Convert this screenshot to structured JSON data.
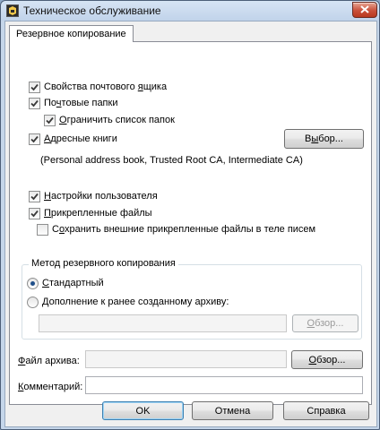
{
  "window": {
    "title": "Техническое обслуживание"
  },
  "tab": {
    "label": "Резервное копирование"
  },
  "options": {
    "mailbox_properties": {
      "pre": "Свойства почтового ",
      "key": "я",
      "post": "щика",
      "checked": true
    },
    "mail_folders": {
      "pre": "По",
      "key": "ч",
      "post": "товые папки",
      "checked": true
    },
    "limit_folders": {
      "pre": "",
      "key": "О",
      "post": "граничить список папок",
      "checked": true
    },
    "address_books": {
      "pre": "",
      "key": "А",
      "post": "дресные книги",
      "checked": true
    },
    "address_books_note": "(Personal address book, Trusted Root CA, Intermediate CA)",
    "user_settings": {
      "pre": "",
      "key": "Н",
      "post": "астройки пользователя",
      "checked": true
    },
    "attachments": {
      "pre": "",
      "key": "П",
      "post": "рикрепленные файлы",
      "checked": true
    },
    "save_external": {
      "pre": "С",
      "key": "о",
      "post": "хранить внешние прикрепленные файлы в теле писем",
      "checked": false
    }
  },
  "select_button": {
    "pre": "В",
    "key": "ы",
    "post": "бор..."
  },
  "backup_method": {
    "title": "Метод резервного копирования",
    "standard": {
      "pre": "",
      "key": "С",
      "post": "тандартный",
      "selected": true
    },
    "append": {
      "pre": "",
      "key": "Д",
      "post": "ополнение к ранее созданному архиву:",
      "selected": false
    },
    "append_path": "",
    "browse_disabled": {
      "pre": "",
      "key": "О",
      "post": "бзор..."
    }
  },
  "archive": {
    "label_pre": "",
    "label_key": "Ф",
    "label_post": "айл архива:",
    "value": "",
    "browse": {
      "pre": "",
      "key": "О",
      "post": "бзор..."
    }
  },
  "comment": {
    "label_pre": "",
    "label_key": "К",
    "label_post": "омментарий:",
    "value": ""
  },
  "buttons": {
    "ok": "OK",
    "cancel": "Отмена",
    "help": "Справка"
  },
  "icons": {
    "app": "app-icon",
    "close": "close-icon",
    "check": "checkmark-icon"
  },
  "colors": {
    "title_bar": "#c1d3ea",
    "close_button": "#c9503a",
    "client_background": "#f0f0f0",
    "panel_background": "#ffffff",
    "radio_dot": "#1f4f8a"
  }
}
